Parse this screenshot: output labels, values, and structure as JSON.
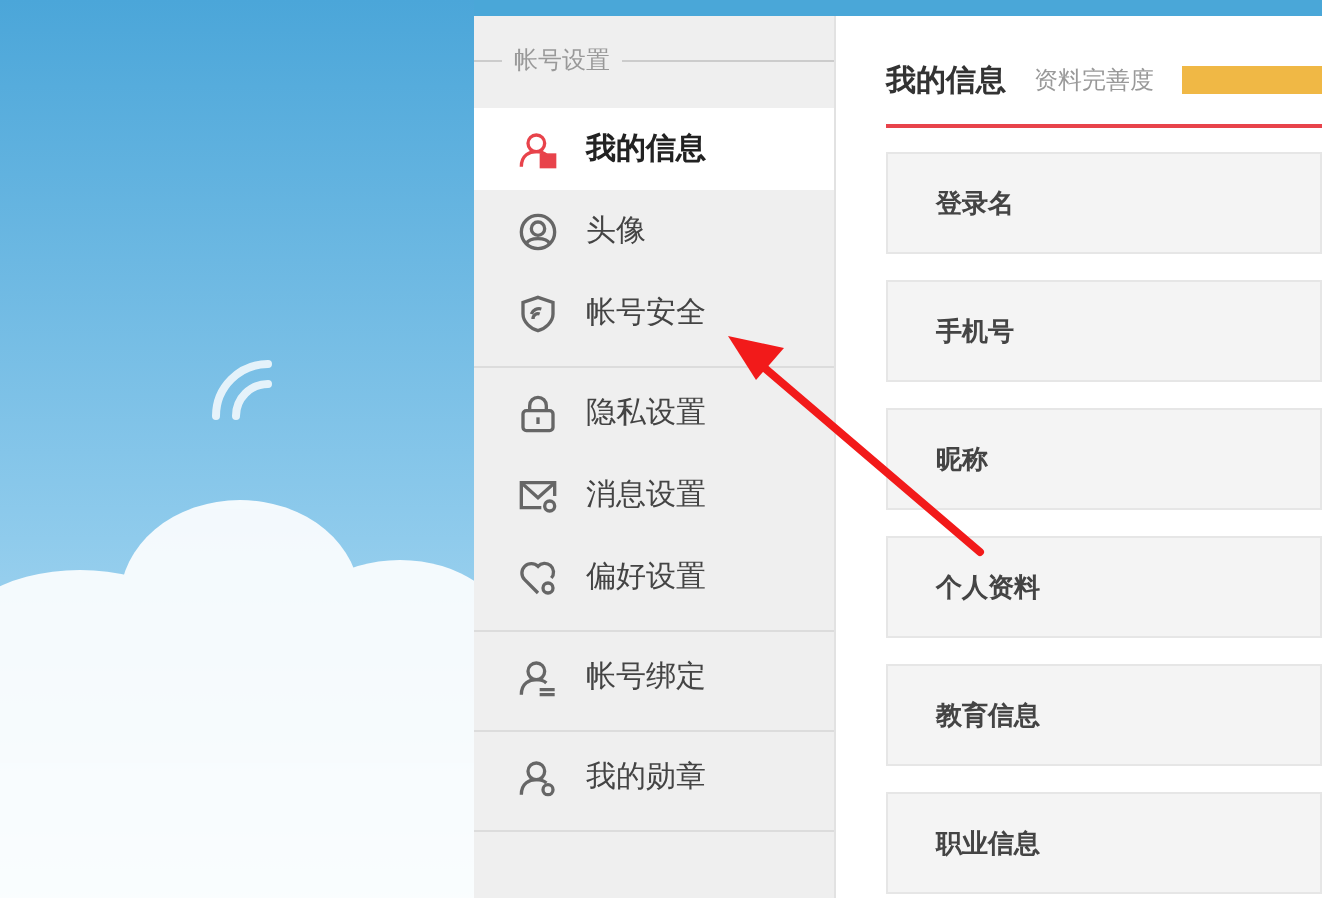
{
  "sidebar": {
    "header": "帐号设置",
    "groups": [
      {
        "items": [
          {
            "label": "我的信息",
            "kind": "user",
            "selected": true
          },
          {
            "label": "头像",
            "kind": "avatar",
            "selected": false
          },
          {
            "label": "帐号安全",
            "kind": "shield",
            "selected": false
          }
        ]
      },
      {
        "items": [
          {
            "label": "隐私设置",
            "kind": "lock",
            "selected": false
          },
          {
            "label": "消息设置",
            "kind": "mail",
            "selected": false
          },
          {
            "label": "偏好设置",
            "kind": "heart",
            "selected": false
          }
        ]
      },
      {
        "items": [
          {
            "label": "帐号绑定",
            "kind": "bind",
            "selected": false
          }
        ]
      },
      {
        "items": [
          {
            "label": "我的勋章",
            "kind": "medal",
            "selected": false
          }
        ]
      }
    ]
  },
  "main": {
    "title": "我的信息",
    "completeness": {
      "label": "资料完善度",
      "level": 1
    },
    "fields": [
      {
        "label": "登录名"
      },
      {
        "label": "手机号"
      },
      {
        "label": "昵称"
      },
      {
        "label": "个人资料"
      },
      {
        "label": "教育信息"
      },
      {
        "label": "职业信息"
      }
    ]
  }
}
